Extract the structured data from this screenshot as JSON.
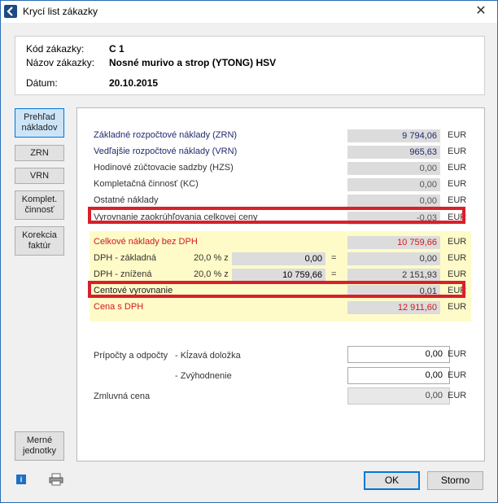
{
  "window": {
    "title": "Krycí list zákazky",
    "close_glyph": "✕"
  },
  "header": {
    "code_label": "Kód zákazky:",
    "code_value": "C 1",
    "name_label": "Názov zákazky:",
    "name_value": "Nosné murivo a strop  (YTONG) HSV",
    "date_label": "Dátum:",
    "date_value": "20.10.2015"
  },
  "sidebar": {
    "overview": "Prehľad\nnákladov",
    "zrn": "ZRN",
    "vrn": "VRN",
    "complete": "Komplet.\nčinnosť",
    "invoice": "Korekcia\nfaktúr",
    "units": "Merné\njednotky"
  },
  "costs": {
    "currency": "EUR",
    "zrn_label": "Základné rozpočtové náklady (ZRN)",
    "zrn_value": "9 794,06",
    "vrn_label": "Vedľajšie rozpočtové náklady (VRN)",
    "vrn_value": "965,63",
    "hzs_label": "Hodinové zúčtovacie sadzby (HZS)",
    "hzs_value": "0,00",
    "kc_label": "Kompletačná činnosť (KC)",
    "kc_value": "0,00",
    "other_label": "Ostatné náklady",
    "other_value": "0,00",
    "rounding_label": "Vyrovnanie zaokrúhľovania celkovej ceny",
    "rounding_value": "-0,03"
  },
  "vat": {
    "total_label": "Celkové náklady bez DPH",
    "total_value": "10 759,66",
    "base_label": "DPH   - základná",
    "base_rate": "20,0 % z",
    "base_amount": "0,00",
    "base_eq": "=",
    "base_value": "0,00",
    "reduced_label": "DPH   - znížená",
    "reduced_rate": "20,0 % z",
    "reduced_amount": "10 759,66",
    "reduced_eq": "=",
    "reduced_value": "2 151,93",
    "cent_label": "Centové vyrovnanie",
    "cent_value": "0,01",
    "price_label": "Cena s DPH",
    "price_value": "12 911,60"
  },
  "adjust": {
    "add_label": "Prípočty a odpočty",
    "sliding_label": "- Kĺzavá doložka",
    "sliding_value": "0,00",
    "discount_label": "- Zvýhodnenie",
    "discount_value": "0,00",
    "contract_label": "Zmluvná cena",
    "contract_value": "0,00"
  },
  "footer": {
    "info_icon": "i",
    "ok": "OK",
    "cancel": "Storno"
  },
  "colors": {
    "highlight": "#d8202b",
    "navy": "#1f2a6e",
    "red": "#d4161d",
    "yellow": "#fffbc8"
  }
}
